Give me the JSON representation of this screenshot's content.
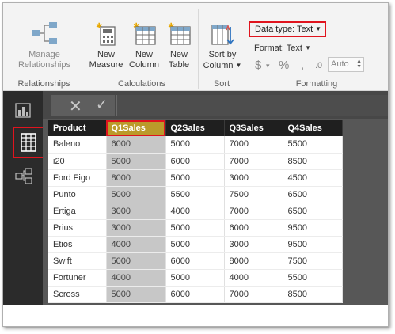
{
  "ribbon": {
    "relationships": {
      "manage_label_1": "Manage",
      "manage_label_2": "Relationships",
      "group_label": "Relationships"
    },
    "calculations": {
      "new_measure_1": "New",
      "new_measure_2": "Measure",
      "new_column_1": "New",
      "new_column_2": "Column",
      "new_table_1": "New",
      "new_table_2": "Table",
      "group_label": "Calculations"
    },
    "sort": {
      "sort_by_1": "Sort by",
      "sort_by_2": "Column",
      "group_label": "Sort"
    },
    "formatting": {
      "data_type_label": "Data type: Text",
      "format_label": "Format: Text",
      "currency_symbol": "$",
      "percent_symbol": "%",
      "comma_symbol": ",",
      "decimals_symbol": ".0",
      "auto_value": "Auto",
      "group_label": "Formatting"
    }
  },
  "formula_bar": {
    "cancel_glyph": "✕",
    "commit_glyph": "✓"
  },
  "table": {
    "columns": [
      "Product",
      "Q1Sales",
      "Q2Sales",
      "Q3Sales",
      "Q4Sales"
    ],
    "selected_column": "Q1Sales",
    "rows": [
      [
        "Baleno",
        "6000",
        "5000",
        "7000",
        "5500"
      ],
      [
        "i20",
        "5000",
        "6000",
        "7000",
        "8500"
      ],
      [
        "Ford Figo",
        "8000",
        "5000",
        "3000",
        "4500"
      ],
      [
        "Punto",
        "5000",
        "5500",
        "7500",
        "6500"
      ],
      [
        "Ertiga",
        "3000",
        "4000",
        "7000",
        "6500"
      ],
      [
        "Prius",
        "3000",
        "5000",
        "6000",
        "9500"
      ],
      [
        "Etios",
        "4000",
        "5000",
        "3000",
        "9500"
      ],
      [
        "Swift",
        "5000",
        "6000",
        "8000",
        "7500"
      ],
      [
        "Fortuner",
        "4000",
        "5000",
        "4000",
        "5500"
      ],
      [
        "Scross",
        "5000",
        "6000",
        "7000",
        "8500"
      ]
    ]
  },
  "colors": {
    "highlight": "#e0141e",
    "selected_header": "#bb9a2a",
    "nav_bg": "#2b2b2b"
  }
}
